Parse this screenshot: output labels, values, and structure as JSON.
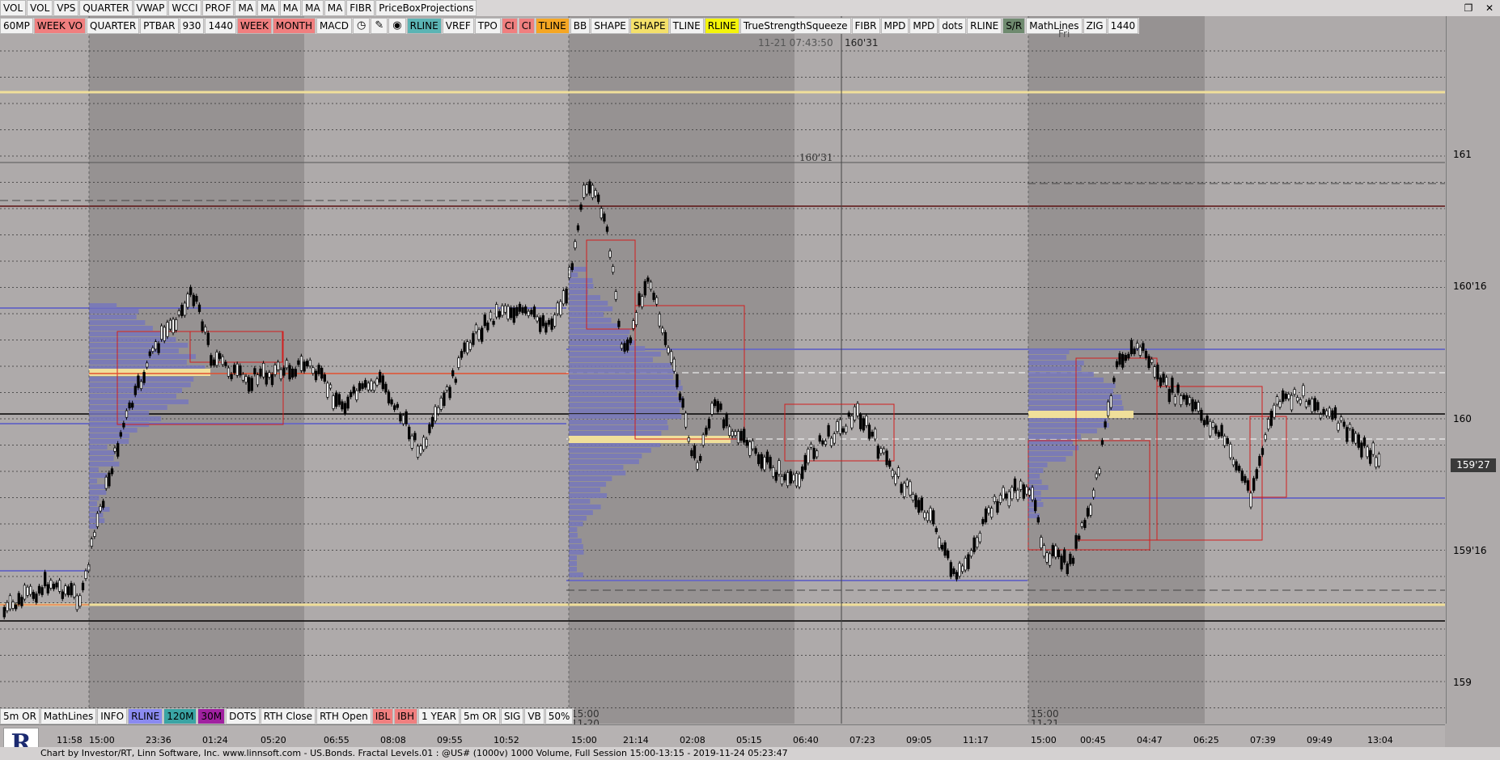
{
  "toolbar_top": [
    "VOL",
    "VOL",
    "VPS",
    "QUARTER",
    "VWAP",
    "WCCI",
    "PROF",
    "MA",
    "MA",
    "MA",
    "MA",
    "MA",
    "FIBR",
    "PriceBoxProjections"
  ],
  "toolbar_second": [
    {
      "label": "60MP",
      "bg": "#f2f2f2"
    },
    {
      "label": "WEEK VO",
      "bg": "#f07f7f"
    },
    {
      "label": "QUARTER",
      "bg": "#f2f2f2"
    },
    {
      "label": "PTBAR",
      "bg": "#f2f2f2"
    },
    {
      "label": "930",
      "bg": "#f2f2f2"
    },
    {
      "label": "1440",
      "bg": "#f2f2f2"
    },
    {
      "label": "WEEK",
      "bg": "#f07f7f"
    },
    {
      "label": "MONTH",
      "bg": "#f07f7f"
    },
    {
      "label": "MACD",
      "bg": "#f2f2f2"
    },
    {
      "label": "◷",
      "bg": "#f2f2f2",
      "icon": "clock-icon"
    },
    {
      "label": "✎",
      "bg": "#f2f2f2",
      "icon": "pencil-icon"
    },
    {
      "label": "◉",
      "bg": "#f2f2f2",
      "icon": "target-icon"
    },
    {
      "label": "RLINE",
      "bg": "#5bb4b4"
    },
    {
      "label": "VREF",
      "bg": "#f2f2f2"
    },
    {
      "label": "TPO",
      "bg": "#f2f2f2"
    },
    {
      "label": "CI",
      "bg": "#f07f7f"
    },
    {
      "label": "CI",
      "bg": "#f07f7f"
    },
    {
      "label": "TLINE",
      "bg": "#f5a623"
    },
    {
      "label": "BB",
      "bg": "#f2f2f2"
    },
    {
      "label": "SHAPE",
      "bg": "#f2f2f2"
    },
    {
      "label": "SHAPE",
      "bg": "#f4e06a"
    },
    {
      "label": "TLINE",
      "bg": "#f2f2f2"
    },
    {
      "label": "RLINE",
      "bg": "#f4f40a"
    },
    {
      "label": "TrueStrengthSqueeze",
      "bg": "#f2f2f2"
    },
    {
      "label": "FIBR",
      "bg": "#f2f2f2"
    },
    {
      "label": "MPD",
      "bg": "#f2f2f2"
    },
    {
      "label": "MPD",
      "bg": "#f2f2f2"
    },
    {
      "label": "dots",
      "bg": "#f2f2f2"
    },
    {
      "label": "RLINE",
      "bg": "#f2f2f2"
    },
    {
      "label": "S/R",
      "bg": "#6f8a6f"
    },
    {
      "label": "MathLines",
      "bg": "#f2f2f2"
    },
    {
      "label": "ZIG",
      "bg": "#f2f2f2"
    },
    {
      "label": "1440",
      "bg": "#f2f2f2"
    }
  ],
  "toolbar_bottom": [
    {
      "label": "5m OR",
      "bg": "#f2f2f2"
    },
    {
      "label": "MathLines",
      "bg": "#f2f2f2"
    },
    {
      "label": "INFO",
      "bg": "#f2f2f2"
    },
    {
      "label": "RLINE",
      "bg": "#8a8af0"
    },
    {
      "label": "120M",
      "bg": "#3aa4a4"
    },
    {
      "label": "30M",
      "bg": "#a020a0"
    },
    {
      "label": "DOTS",
      "bg": "#f2f2f2"
    },
    {
      "label": "RTH Close",
      "bg": "#f2f2f2"
    },
    {
      "label": "RTH Open",
      "bg": "#f2f2f2"
    },
    {
      "label": "IBL",
      "bg": "#f07f7f"
    },
    {
      "label": "IBH",
      "bg": "#f07f7f"
    },
    {
      "label": "1 YEAR",
      "bg": "#f2f2f2"
    },
    {
      "label": "5m OR",
      "bg": "#f2f2f2"
    },
    {
      "label": "SIG",
      "bg": "#f2f2f2"
    },
    {
      "label": "VB",
      "bg": "#f2f2f2"
    },
    {
      "label": "50%",
      "bg": "#f2f2f2"
    }
  ],
  "chart": {
    "crosshair_time": "11-21 07:43:50",
    "crosshair_price": "160'31",
    "crosshair_price_label": "160'31",
    "day_label": "Fri",
    "session_labels": [
      {
        "time": "15:00",
        "date": "11-20"
      },
      {
        "time": "15:00",
        "date": "11-21"
      }
    ],
    "price_ticks": [
      "161",
      "160'16",
      "160",
      "159'16",
      "159"
    ],
    "current_price": "159'27",
    "time_ticks": [
      "11:58",
      "15:00",
      "23:36",
      "01:24",
      "05:20",
      "06:55",
      "08:08",
      "09:55",
      "10:52",
      "15:00",
      "21:14",
      "02:08",
      "05:15",
      "06:40",
      "07:23",
      "09:05",
      "11:17",
      "15:00",
      "00:45",
      "04:47",
      "06:25",
      "07:39",
      "09:49",
      "13:04"
    ]
  },
  "status_bar": "Chart by Investor/RT, Linn Software, Inc. www.linnsoft.com - US.Bonds. Fractal Levels.01   : @US# (1000v) 1000 Volume, Full Session 15:00-13:15 - 2019-11-24 05:23:47",
  "logo_letter": "R",
  "colors": {
    "background": "#aeaaaa",
    "session_shade": "#8e8989",
    "profile_blue": "#7777bb",
    "poc_yellow": "#f0df9a",
    "candle_up": "#ffffff",
    "candle_down": "#000000",
    "red_box": "#d21e1e"
  }
}
